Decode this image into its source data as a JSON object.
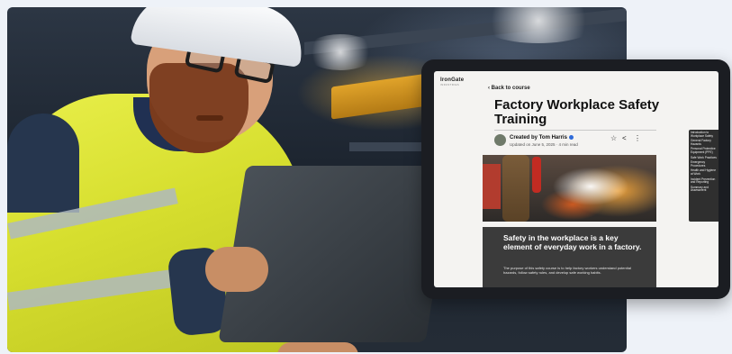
{
  "course_page": {
    "logo": "IronGate",
    "logo_tagline": "INDUSTRIES",
    "back_link": "‹ Back to course",
    "title": "Factory Workplace Safety Training",
    "author_line": "Created by Tom Harris",
    "updated_line": "Updated on June 5, 2025 · 4 min read",
    "actions": {
      "bookmark_icon": "☆",
      "share_icon": "<",
      "more_icon": "⋮"
    },
    "callout": {
      "heading": "Safety in the workplace is a key element of everyday work in a factory.",
      "body": "The purpose of this safety course is to help factory workers understand potential hazards, follow safety rules, and develop safe working habits."
    },
    "toc": [
      "Introduction to Workplace Safety",
      "General Factory Hazards",
      "Personal Protective Equipment (PPE)",
      "Safe Work Practices",
      "Emergency Procedures",
      "Health and Hygiene at Work",
      "Incident Prevention and Reporting",
      "Summary and Assessment"
    ]
  },
  "colors": {
    "tablet_frame": "#1b1d22",
    "screen_bg": "#f4f3f1",
    "callout_bg": "#3b3b3b",
    "verified_badge": "#2f6bd9"
  }
}
